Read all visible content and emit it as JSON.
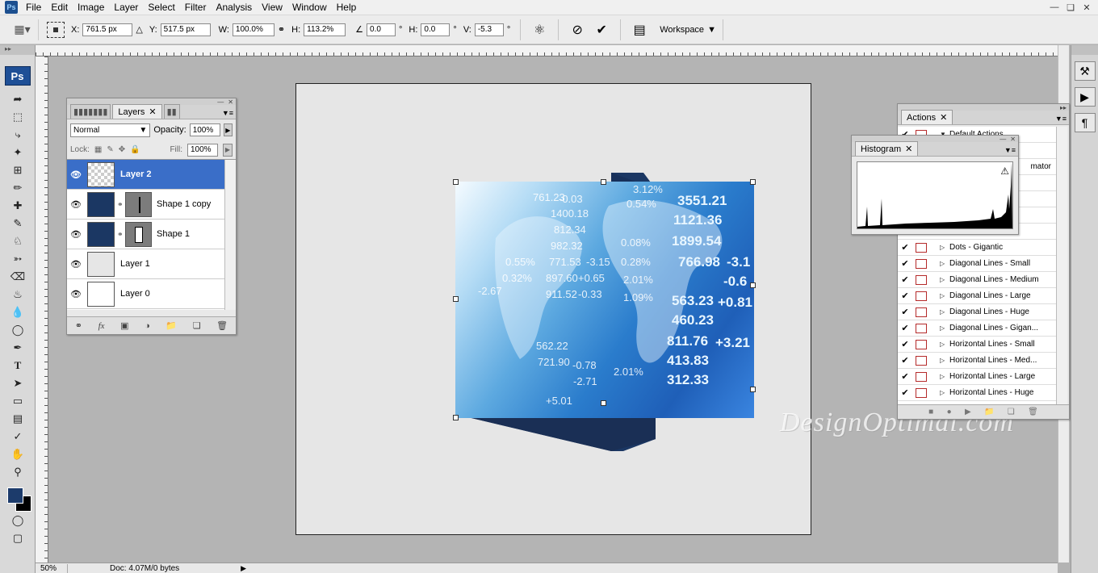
{
  "menubar": {
    "logo": "Ps",
    "items": [
      "File",
      "Edit",
      "Image",
      "Layer",
      "Select",
      "Filter",
      "Analysis",
      "View",
      "Window",
      "Help"
    ]
  },
  "options": {
    "x_label": "X:",
    "x_value": "761.5 px",
    "y_label": "Y:",
    "y_value": "517.5 px",
    "w_label": "W:",
    "w_value": "100.0%",
    "h_label": "H:",
    "h_value": "113.2%",
    "rotate_value": "0.0",
    "hskew_label": "H:",
    "hskew_value": "0.0",
    "vskew_label": "V:",
    "vskew_value": "-5.3",
    "degree": "°",
    "workspace_label": "Workspace"
  },
  "toolbox": {
    "badge": "Ps"
  },
  "layers_panel": {
    "tab_label": "Layers",
    "blend_mode": "Normal",
    "opacity_label": "Opacity:",
    "opacity_value": "100%",
    "lock_label": "Lock:",
    "fill_label": "Fill:",
    "fill_value": "100%",
    "layers": [
      {
        "name": "Layer 2",
        "selected": true
      },
      {
        "name": "Shape 1 copy",
        "selected": false
      },
      {
        "name": "Shape 1",
        "selected": false
      },
      {
        "name": "Layer 1",
        "selected": false
      },
      {
        "name": "Layer 0",
        "selected": false
      }
    ]
  },
  "actions_panel": {
    "tab_label": "Actions",
    "set_name": "Default Actions",
    "partial_item": "mator",
    "items": [
      "Dots - Gigantic",
      "Diagonal Lines - Small",
      "Diagonal Lines - Medium",
      "Diagonal Lines - Large",
      "Diagonal Lines - Huge",
      "Diagonal Lines - Gigan...",
      "Horizontal Lines - Small",
      "Horizontal Lines - Med...",
      "Horizontal Lines - Large",
      "Horizontal Lines - Huge"
    ]
  },
  "histogram_panel": {
    "tab_label": "Histogram"
  },
  "artwork": {
    "numbers": [
      "-0.03",
      "3.12%",
      "3551.21",
      "761.23",
      "1400.18",
      "1121.36",
      "812.34",
      "0.54%",
      "982.32",
      "1899.54",
      "0.08%",
      "771.53",
      "-3.15",
      "766.98",
      "0.28%",
      "897.60",
      "+0.65",
      "2.01%",
      "911.52",
      "-0.33",
      "1.09%",
      "563.23",
      "+0.81",
      "460.23",
      "811.76",
      "+3.21",
      "562.22",
      "413.83",
      "-0.78",
      "721.90",
      "2.01%",
      "-2.71",
      "312.33",
      "+5.01",
      "0.55%",
      "0.32%",
      "-2.67",
      "-0.6",
      "-3.1"
    ]
  },
  "watermark": "DesignOptimal.com",
  "statusbar": {
    "zoom": "50%",
    "doc": "Doc: 4.07M/0 bytes"
  },
  "colors": {
    "foreground": "#1c3b6b",
    "background": "#000000",
    "selection": "#3a6ec8"
  }
}
